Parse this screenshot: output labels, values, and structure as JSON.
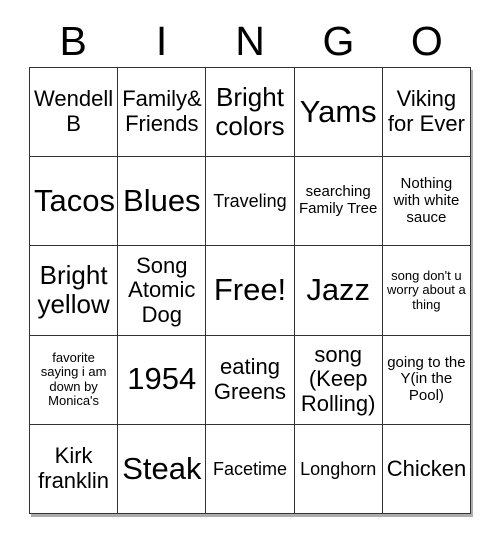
{
  "card": {
    "header_letters": [
      "B",
      "I",
      "N",
      "G",
      "O"
    ],
    "columns": 5,
    "rows": 5,
    "border_color": "#333333",
    "background_color": "#ffffff",
    "text_color": "#000000",
    "free_space_index": 12,
    "cells": [
      {
        "text": "Wendell B",
        "size": "md"
      },
      {
        "text": "Family& Friends",
        "size": "md"
      },
      {
        "text": "Bright colors",
        "size": "lg"
      },
      {
        "text": "Yams",
        "size": "xl"
      },
      {
        "text": "Viking for Ever",
        "size": "md"
      },
      {
        "text": "Tacos",
        "size": "xl"
      },
      {
        "text": "Blues",
        "size": "xl"
      },
      {
        "text": "Traveling",
        "size": "sm"
      },
      {
        "text": "searching Family Tree",
        "size": "xs"
      },
      {
        "text": "Nothing with white sauce",
        "size": "xs"
      },
      {
        "text": "Bright yellow",
        "size": "lg"
      },
      {
        "text": "Song Atomic Dog",
        "size": "md"
      },
      {
        "text": "Free!",
        "size": "xl"
      },
      {
        "text": "Jazz",
        "size": "xl"
      },
      {
        "text": "song don't u worry about a thing",
        "size": "xxs"
      },
      {
        "text": "favorite saying i am down by Monica's",
        "size": "xxs"
      },
      {
        "text": "1954",
        "size": "xl"
      },
      {
        "text": "eating Greens",
        "size": "md"
      },
      {
        "text": "song (Keep Rolling)",
        "size": "md"
      },
      {
        "text": "going to the Y(in the Pool)",
        "size": "xs"
      },
      {
        "text": "Kirk franklin",
        "size": "md"
      },
      {
        "text": "Steak",
        "size": "xl"
      },
      {
        "text": "Facetime",
        "size": "sm"
      },
      {
        "text": "Longhorn",
        "size": "sm"
      },
      {
        "text": "Chicken",
        "size": "md"
      }
    ]
  }
}
